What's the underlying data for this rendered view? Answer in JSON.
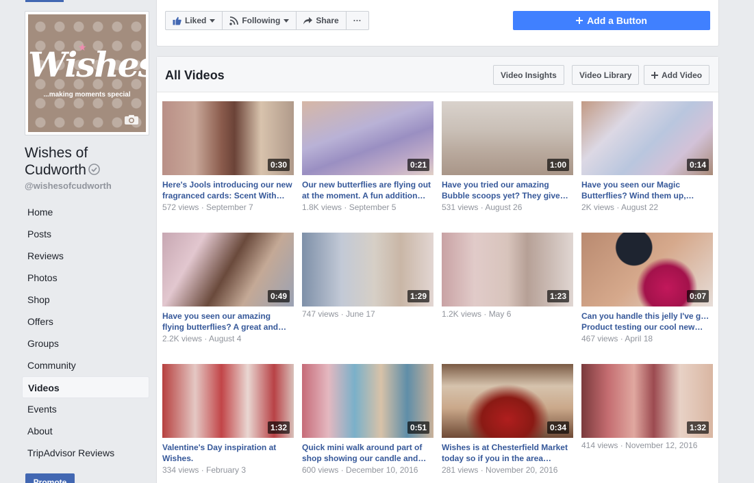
{
  "page": {
    "name_line1": "Wishes of",
    "name_line2": "Cudworth",
    "handle": "@wishesofcudworth",
    "logo_text": "Wishes",
    "logo_tagline": "...making moments special"
  },
  "nav": {
    "items": [
      {
        "label": "Home"
      },
      {
        "label": "Posts"
      },
      {
        "label": "Reviews"
      },
      {
        "label": "Photos"
      },
      {
        "label": "Shop"
      },
      {
        "label": "Offers"
      },
      {
        "label": "Groups"
      },
      {
        "label": "Community"
      },
      {
        "label": "Videos",
        "active": true
      },
      {
        "label": "Events"
      },
      {
        "label": "About"
      },
      {
        "label": "TripAdvisor Reviews"
      }
    ],
    "promote_label": "Promote"
  },
  "actions": {
    "liked": "Liked",
    "following": "Following",
    "share": "Share",
    "more": "···",
    "add_button": "Add a Button"
  },
  "videos": {
    "title": "All Videos",
    "insights_label": "Video Insights",
    "library_label": "Video Library",
    "add_video_label": "Add Video",
    "items": [
      {
        "duration": "0:30",
        "title1": "Here's Jools introducing our new",
        "title2": "fragranced cards: Scent With…",
        "meta": "572 views · September 7"
      },
      {
        "duration": "0:21",
        "title1": "Our new butterflies are flying out",
        "title2": "at the moment. A fun addition…",
        "meta": "1.8K views · September 5"
      },
      {
        "duration": "1:00",
        "title1": "Have you tried our amazing",
        "title2": "Bubble scoops yet? They give…",
        "meta": "531 views · August 26"
      },
      {
        "duration": "0:14",
        "title1": "Have you seen our Magic",
        "title2": "Butterflies? Wind them up,…",
        "meta": "2K views · August 22"
      },
      {
        "duration": "0:49",
        "title1": "Have you seen our amazing",
        "title2": "flying butterflies? A great and…",
        "meta": "2.2K views · August 4"
      },
      {
        "duration": "1:29",
        "title1": "",
        "title2": "",
        "meta": "747 views · June 17"
      },
      {
        "duration": "1:23",
        "title1": "",
        "title2": "",
        "meta": "1.2K views · May 6"
      },
      {
        "duration": "0:07",
        "title1": "Can you handle this jelly I've got?",
        "title2": "Product testing our cool new…",
        "meta": "467 views · April 18"
      },
      {
        "duration": "1:32",
        "title1": "Valentine's Day inspiration at",
        "title2": "Wishes.",
        "meta": "334 views · February 3"
      },
      {
        "duration": "0:51",
        "title1": "Quick mini walk around part of",
        "title2": "shop showing our candle and…",
        "meta": "600 views · December 10, 2016"
      },
      {
        "duration": "0:34",
        "title1": "Wishes is at Chesterfield Market",
        "title2": "today so if you in the area…",
        "meta": "281 views · November 20, 2016"
      },
      {
        "duration": "1:32",
        "title1": "",
        "title2": "",
        "meta": "414 views · November 12, 2016"
      }
    ]
  },
  "colors": {
    "brand_blue": "#4267b2",
    "link_blue": "#365899",
    "cta_blue": "#4080ff"
  }
}
